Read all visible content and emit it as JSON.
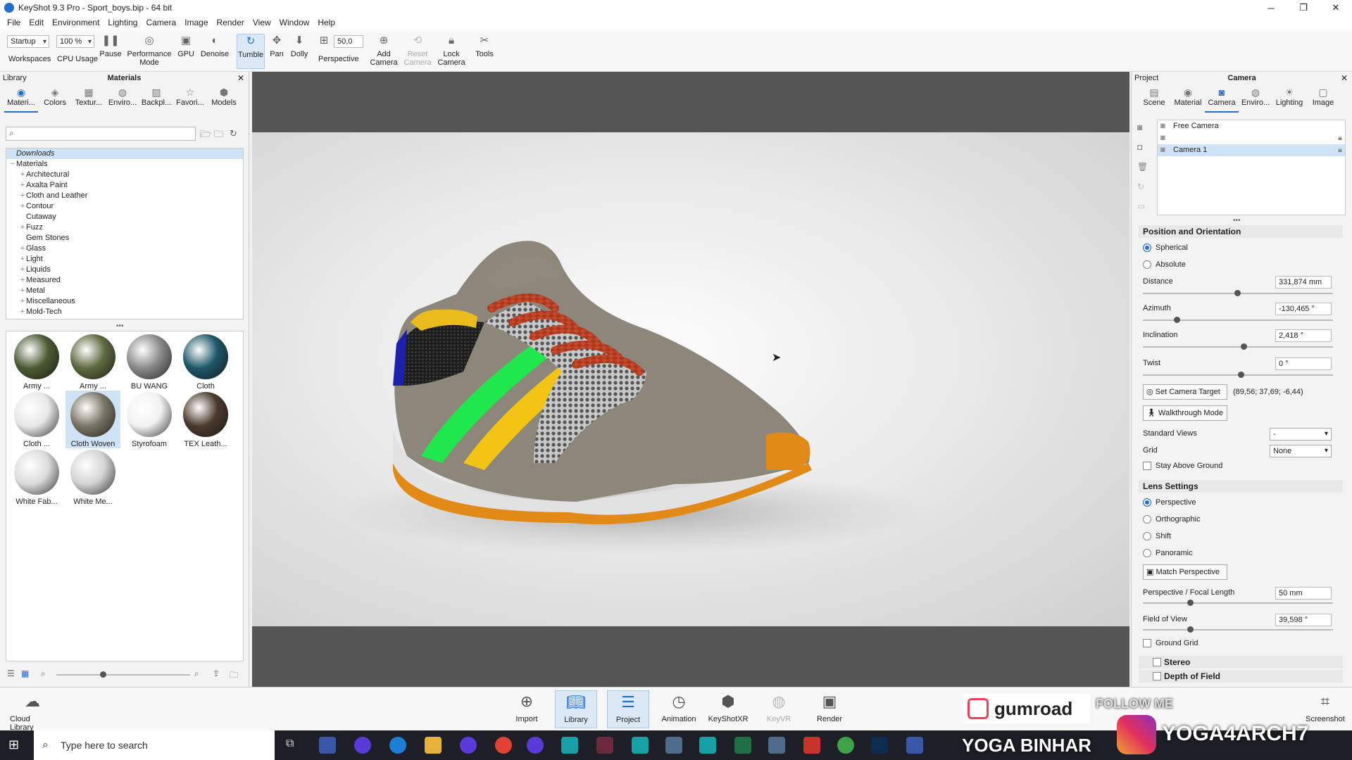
{
  "window": {
    "title": "KeyShot 9.3 Pro - Sport_boys.bip - 64 bit"
  },
  "menu": [
    "File",
    "Edit",
    "Environment",
    "Lighting",
    "Camera",
    "Image",
    "Render",
    "View",
    "Window",
    "Help"
  ],
  "ribbon": {
    "workspace_value": "Startup",
    "workspaces_label": "Workspaces",
    "cpu_value": "100 %",
    "cpu_label": "CPU Usage",
    "pause": "Pause",
    "performance": "Performance Mode",
    "gpu": "GPU",
    "denoise": "Denoise",
    "tumble": "Tumble",
    "pan": "Pan",
    "dolly": "Dolly",
    "perspective_value": "50,0",
    "perspective": "Perspective",
    "add_camera": "Add Camera",
    "reset_camera": "Reset Camera",
    "lock_camera": "Lock Camera",
    "tools": "Tools"
  },
  "library": {
    "header_left": "Library",
    "header_center": "Materials",
    "tabs": [
      "Materi...",
      "Colors",
      "Textur...",
      "Enviro...",
      "Backpl...",
      "Favori...",
      "Models"
    ],
    "tree": [
      {
        "label": "Downloads",
        "exp": "",
        "indent": 0,
        "sel": true
      },
      {
        "label": "Materials",
        "exp": "−",
        "indent": 0
      },
      {
        "label": "Architectural",
        "exp": "+",
        "indent": 1
      },
      {
        "label": "Axalta Paint",
        "exp": "+",
        "indent": 1
      },
      {
        "label": "Cloth and Leather",
        "exp": "+",
        "indent": 1
      },
      {
        "label": "Contour",
        "exp": "+",
        "indent": 1
      },
      {
        "label": "Cutaway",
        "exp": "",
        "indent": 1
      },
      {
        "label": "Fuzz",
        "exp": "+",
        "indent": 1
      },
      {
        "label": "Gem Stones",
        "exp": "",
        "indent": 1
      },
      {
        "label": "Glass",
        "exp": "+",
        "indent": 1
      },
      {
        "label": "Light",
        "exp": "+",
        "indent": 1
      },
      {
        "label": "Liquids",
        "exp": "+",
        "indent": 1
      },
      {
        "label": "Measured",
        "exp": "+",
        "indent": 1
      },
      {
        "label": "Metal",
        "exp": "+",
        "indent": 1
      },
      {
        "label": "Miscellaneous",
        "exp": "+",
        "indent": 1
      },
      {
        "label": "Mold-Tech",
        "exp": "+",
        "indent": 1
      }
    ],
    "materials": [
      {
        "label": "Army ...",
        "color": "#4a5a32"
      },
      {
        "label": "Army ...",
        "color": "#5d6a3e"
      },
      {
        "label": "BU WANG",
        "color": "#8a8a8a"
      },
      {
        "label": "Cloth",
        "color": "#1d5668"
      },
      {
        "label": "Cloth ...",
        "color": "#e8e8e8"
      },
      {
        "label": "Cloth Woven",
        "color": "#7a7666",
        "sel": true
      },
      {
        "label": "Styrofoam",
        "color": "#f2f2f2"
      },
      {
        "label": "TEX Leath...",
        "color": "#4a3a2c"
      },
      {
        "label": "White Fab...",
        "color": "#dcdcdc"
      },
      {
        "label": "White Me...",
        "color": "#d4d4d4"
      }
    ]
  },
  "project": {
    "header_left": "Project",
    "header_center": "Camera",
    "tabs": [
      "Scene",
      "Material",
      "Camera",
      "Enviro...",
      "Lighting",
      "Image"
    ],
    "cameras": [
      "Free Camera",
      "",
      "Camera 1"
    ],
    "position_header": "Position and Orientation",
    "spherical": "Spherical",
    "absolute": "Absolute",
    "distance_label": "Distance",
    "distance_value": "331,874 mm",
    "azimuth_label": "Azimuth",
    "azimuth_value": "-130,465 °",
    "inclination_label": "Inclination",
    "inclination_value": "2,418 °",
    "twist_label": "Twist",
    "twist_value": "0 °",
    "set_target": "Set Camera Target",
    "target_coords": "(89,56; 37,69; -6,44)",
    "walkthrough": "Walkthrough Mode",
    "std_views_label": "Standard Views",
    "std_views_value": "-",
    "grid_label": "Grid",
    "grid_value": "None",
    "stay_above": "Stay Above Ground",
    "lens_header": "Lens Settings",
    "perspective": "Perspective",
    "orthographic": "Orthographic",
    "shift": "Shift",
    "panoramic": "Panoramic",
    "match_persp": "Match Perspective",
    "focal_label": "Perspective / Focal Length",
    "focal_value": "50 mm",
    "fov_label": "Field of View",
    "fov_value": "39,598 °",
    "ground_grid": "Ground Grid",
    "stereo": "Stereo",
    "dof": "Depth of Field"
  },
  "dock": {
    "cloud": "Cloud Library",
    "import": "Import",
    "library": "Library",
    "project": "Project",
    "animation": "Animation",
    "keyshotxr": "KeyShotXR",
    "keyvr": "KeyVR",
    "render": "Render",
    "screenshot": "Screenshot"
  },
  "taskbar": {
    "search_placeholder": "Type here to search"
  },
  "watermark": {
    "gumroad": "gumroad",
    "name": "YOGA BINHAR",
    "follow": "FOLLOW ME",
    "handle": "YOGA4ARCH7"
  }
}
